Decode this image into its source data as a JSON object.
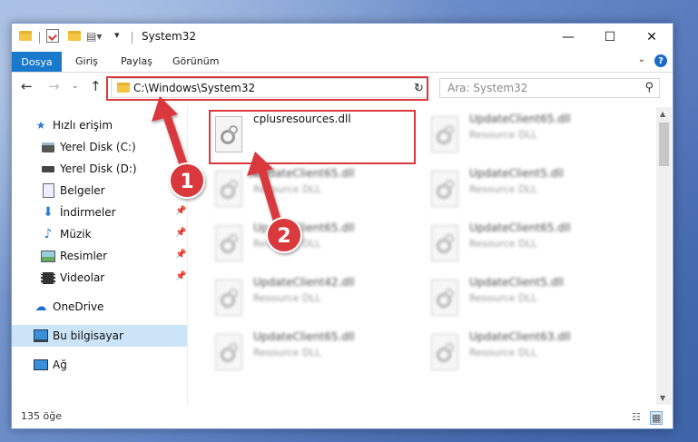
{
  "window": {
    "title": "System32",
    "controls": {
      "minimize": "—",
      "maximize": "☐",
      "close": "✕"
    }
  },
  "ribbon": {
    "tabs": [
      "Dosya",
      "Giriş",
      "Paylaş",
      "Görünüm"
    ],
    "help_label": "?"
  },
  "address": {
    "path": "C:\\Windows\\System32"
  },
  "search": {
    "placeholder": "Ara: System32"
  },
  "sidebar": {
    "items": [
      {
        "label": "Hızlı erişim",
        "icon": "star-icon",
        "pinned": false
      },
      {
        "label": "Yerel Disk (C:)",
        "icon": "drive-icon",
        "pinned": false
      },
      {
        "label": "Yerel Disk (D:)",
        "icon": "drive-icon",
        "pinned": false
      },
      {
        "label": "Belgeler",
        "icon": "document-icon",
        "pinned": false
      },
      {
        "label": "İndirmeler",
        "icon": "download-icon",
        "pinned": true
      },
      {
        "label": "Müzik",
        "icon": "music-icon",
        "pinned": true
      },
      {
        "label": "Resimler",
        "icon": "pictures-icon",
        "pinned": true
      },
      {
        "label": "Videolar",
        "icon": "video-icon",
        "pinned": true
      },
      {
        "label": "OneDrive",
        "icon": "cloud-icon",
        "pinned": false
      },
      {
        "label": "Bu bilgisayar",
        "icon": "computer-icon",
        "pinned": false,
        "selected": true
      },
      {
        "label": "Ağ",
        "icon": "network-icon",
        "pinned": false
      }
    ]
  },
  "files": {
    "highlighted": {
      "name": "cplusresources.dll",
      "type": ""
    },
    "left_column": [
      {
        "name": "UpdateClient65.dll",
        "type": "Resource DLL"
      },
      {
        "name": "UpdateClient65.dll",
        "type": "Resource DLL"
      },
      {
        "name": "UpdateClient42.dll",
        "type": "Resource DLL"
      },
      {
        "name": "UpdateClient65.dll",
        "type": "Resource DLL"
      }
    ],
    "right_column": [
      {
        "name": "UpdateClient65.dll",
        "type": "Resource DLL"
      },
      {
        "name": "UpdateClient5.dll",
        "type": "Resource DLL"
      },
      {
        "name": "UpdateClient65.dll",
        "type": "Resource DLL"
      },
      {
        "name": "UpdateClient5.dll",
        "type": "Resource DLL"
      },
      {
        "name": "UpdateClient63.dll",
        "type": "Resource DLL"
      }
    ]
  },
  "status": {
    "item_count": "135 öğe"
  },
  "annotations": {
    "badge1": "1",
    "badge2": "2",
    "color": "#d9393d"
  }
}
